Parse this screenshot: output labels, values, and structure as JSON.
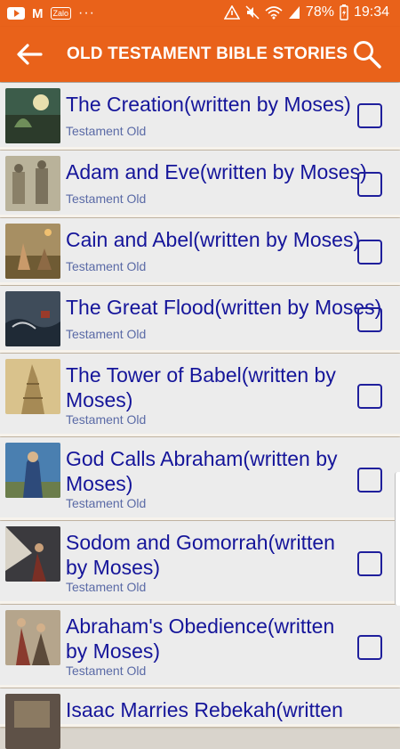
{
  "status_bar": {
    "battery": "78%",
    "time": "19:34",
    "icons": [
      "youtube-icon",
      "gmail-icon",
      "zalo-icon",
      "more-dots-icon",
      "alert-icon",
      "mute-icon",
      "wifi-icon",
      "signal-icon",
      "battery-icon"
    ],
    "zalo_label": "Zalo",
    "more": "···"
  },
  "app_bar": {
    "title": "OLD TESTAMENT BIBLE STORIES",
    "background": "#e9621a"
  },
  "stories": [
    {
      "title": "The Creation(written by Moses)",
      "subtitle": "Testament Old",
      "checked": false
    },
    {
      "title": "Adam and Eve(written by Moses)",
      "subtitle": "Testament Old",
      "checked": false
    },
    {
      "title": "Cain and Abel(written by Moses)",
      "subtitle": "Testament Old",
      "checked": false
    },
    {
      "title": "The Great Flood(written by Moses)",
      "subtitle": "Testament Old",
      "checked": false
    },
    {
      "title": "The Tower of Babel(written by Moses)",
      "subtitle": "Testament Old",
      "checked": false
    },
    {
      "title": "God Calls Abraham(written by Moses)",
      "subtitle": "Testament Old",
      "checked": false
    },
    {
      "title": "Sodom and Gomorrah(written by Moses)",
      "subtitle": "Testament Old",
      "checked": false
    },
    {
      "title": "Abraham's Obedience(written by Moses)",
      "subtitle": "Testament Old",
      "checked": false
    },
    {
      "title": "Isaac Marries Rebekah(written",
      "subtitle": "",
      "checked": false
    }
  ]
}
